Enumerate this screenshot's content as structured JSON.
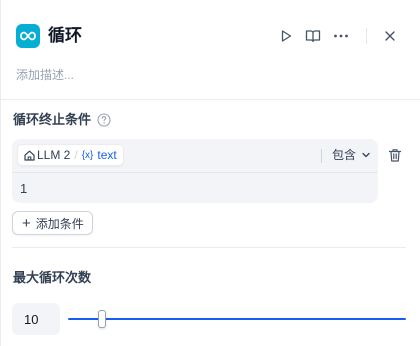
{
  "node": {
    "title": "循环",
    "description_placeholder": "添加描述...",
    "accent_color": "#06aed4"
  },
  "header_actions": {
    "run_icon": "play-icon",
    "docs_icon": "book-open-icon",
    "more_icon": "more-horizontal-icon",
    "close_icon": "close-icon"
  },
  "stop_condition": {
    "title": "循环终止条件",
    "help_icon": "question-circle-icon",
    "conditions": [
      {
        "source_icon": "home-icon",
        "source_node": "LLM 2",
        "separator": "/",
        "variable_icon": "variable-brace-icon",
        "variable_brace": "{x}",
        "variable_name": "text",
        "operator": "包含",
        "value": "1"
      }
    ],
    "add_button_label": "添加条件",
    "delete_icon": "trash-icon"
  },
  "max_loop": {
    "title": "最大循环次数",
    "value": "10",
    "slider_fraction": 0.1,
    "accent_color": "#155eef"
  }
}
